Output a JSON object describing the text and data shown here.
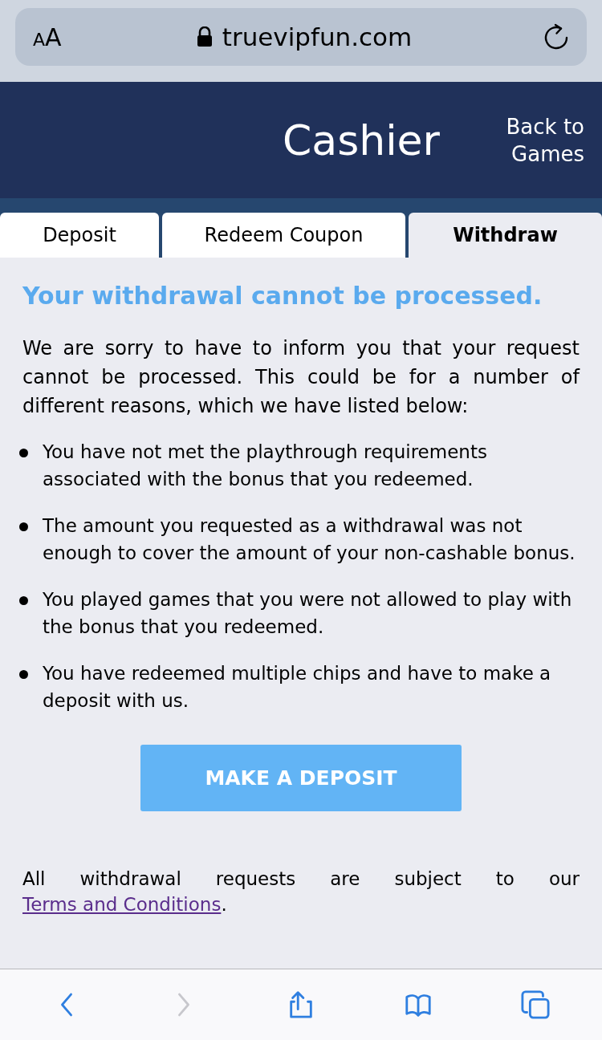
{
  "address_bar": {
    "text_size": "AA",
    "url": "truevipfun.com"
  },
  "header": {
    "title": "Cashier",
    "back_link": "Back to Games"
  },
  "tabs": [
    {
      "label": "Deposit",
      "selected": false
    },
    {
      "label": "Redeem Coupon",
      "selected": false
    },
    {
      "label": "Withdraw",
      "selected": true
    }
  ],
  "message": {
    "heading": "Your withdrawal cannot be processed.",
    "intro": "We are sorry to have to inform you that your request cannot be processed. This could be for a number of different reasons, which we have listed below:",
    "reasons": [
      "You have not met the playthrough requirements associated with the bonus that you redeemed.",
      "The amount you requested as a withdrawal was not enough to cover the amount of your non-cashable bonus.",
      "You played games that you were not allowed to play with the bonus that you redeemed.",
      "You have redeemed multiple chips and have to make a deposit with us."
    ],
    "button": "MAKE A DEPOSIT",
    "footer": "All withdrawal requests are subject to our",
    "footer_link": "Terms and Conditions",
    "footer_end": "."
  },
  "toolbar": [
    {
      "kind": "back",
      "disabled": false
    },
    {
      "kind": "forward",
      "disabled": true
    },
    {
      "kind": "share",
      "disabled": false
    },
    {
      "kind": "bookmarks",
      "disabled": false
    },
    {
      "kind": "tabs",
      "disabled": false
    }
  ]
}
